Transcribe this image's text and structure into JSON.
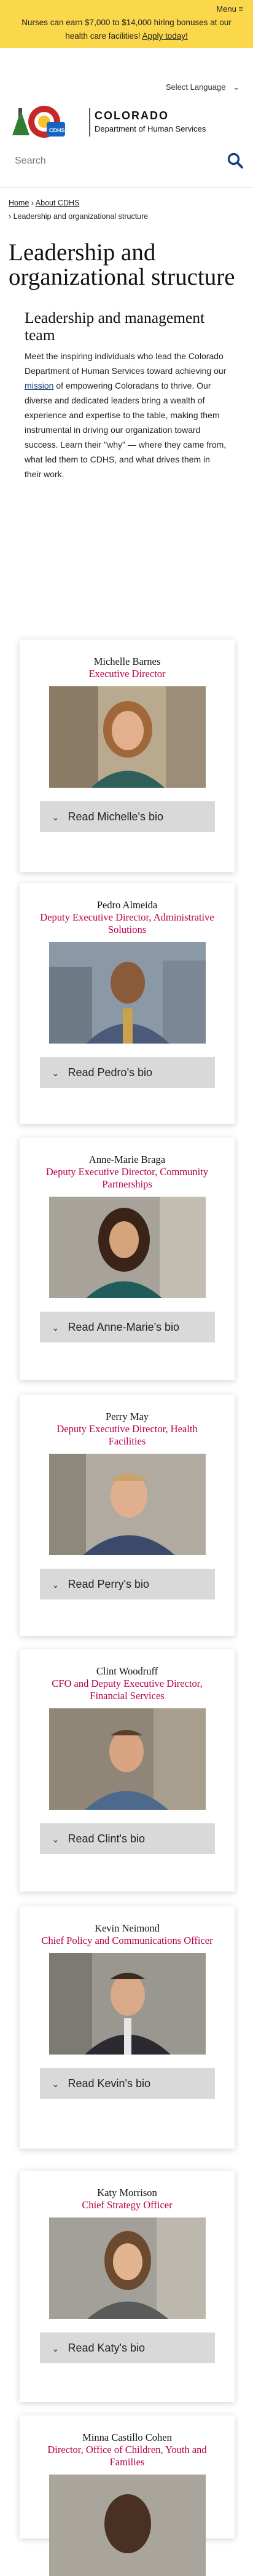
{
  "header": {
    "menu_label": "Menu ≡",
    "banner_text": "Nurses can earn $7,000 to $14,000 hiring bonuses at our health care facilities!",
    "banner_link": "Apply today!",
    "language_label": "Select Language",
    "logo_title": "COLORADO",
    "logo_subtitle": "Department of Human Services",
    "logo_badge": "CDHS",
    "search_placeholder": "Search"
  },
  "breadcrumb": {
    "home": "Home",
    "about": "About CDHS",
    "current": "Leadership and organizational structure"
  },
  "page_title": "Leadership and organizational structure",
  "section": {
    "heading": "Leadership and management team",
    "intro_before": "Meet the inspiring individuals who lead the Colorado Department of Human Services toward achieving our ",
    "intro_link": "mission",
    "intro_after": " of empowering Coloradans to thrive. Our diverse and dedicated leaders bring a wealth of experience and expertise to the table, making them instrumental in driving our organization toward success. Learn their \"why\" — where they came from, what led them to CDHS, and what drives them in their work."
  },
  "leaders": [
    {
      "name": "Michelle Barnes",
      "title": "Executive Director",
      "button": "Read Michelle's bio"
    },
    {
      "name": "Pedro Almeida",
      "title": "Deputy Executive Director, Administrative Solutions",
      "button": "Read Pedro's bio"
    },
    {
      "name": "Anne-Marie Braga",
      "title": "Deputy Executive Director, Community Partnerships",
      "button": "Read Anne-Marie's bio"
    },
    {
      "name": "Perry May",
      "title": "Deputy Executive Director, Health Facilities",
      "button": "Read Perry's bio"
    },
    {
      "name": "Clint Woodruff",
      "title": "CFO and Deputy Executive Director, Financial Services",
      "button": "Read Clint's bio"
    },
    {
      "name": "Kevin Neimond",
      "title": "Chief Policy and Communications Officer",
      "button": "Read Kevin's bio"
    },
    {
      "name": "Katy Morrison",
      "title": "Chief Strategy Officer",
      "button": "Read Katy's bio"
    },
    {
      "name": "Minna Castillo Cohen",
      "title": "Director, Office of Children, Youth and Families",
      "button": ""
    }
  ],
  "colors": {
    "banner": "#fbd74b",
    "accent": "#b7004c",
    "link": "#1a3d7c"
  }
}
